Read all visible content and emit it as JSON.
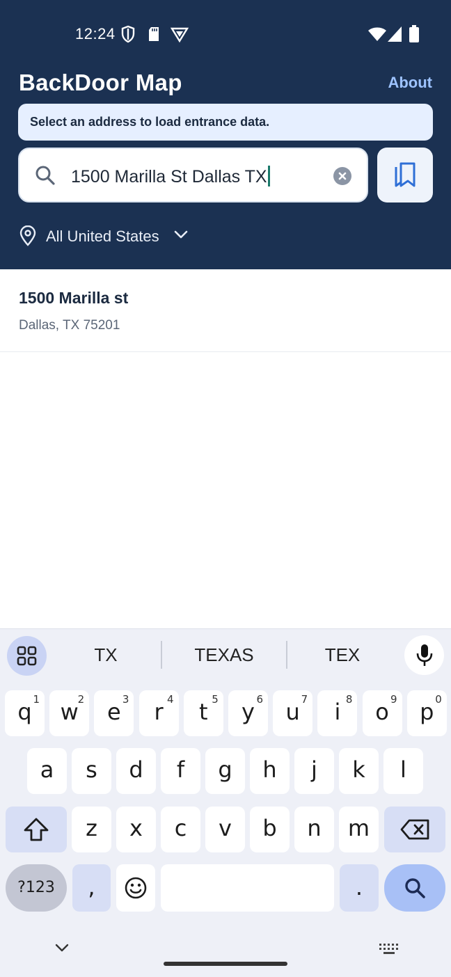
{
  "status_bar": {
    "time": "12:24"
  },
  "app": {
    "title": "BackDoor Map",
    "about_label": "About"
  },
  "banner": {
    "text": "Select an address to load entrance data."
  },
  "search": {
    "value": "1500 Marilla St Dallas TX"
  },
  "region": {
    "label": "All United States"
  },
  "results": [
    {
      "title": "1500 Marilla st",
      "subtitle": "Dallas, TX 75201"
    }
  ],
  "keyboard": {
    "suggestions": [
      "TX",
      "TEXAS",
      "TEX"
    ],
    "row1": [
      {
        "k": "q",
        "h": "1"
      },
      {
        "k": "w",
        "h": "2"
      },
      {
        "k": "e",
        "h": "3"
      },
      {
        "k": "r",
        "h": "4"
      },
      {
        "k": "t",
        "h": "5"
      },
      {
        "k": "y",
        "h": "6"
      },
      {
        "k": "u",
        "h": "7"
      },
      {
        "k": "i",
        "h": "8"
      },
      {
        "k": "o",
        "h": "9"
      },
      {
        "k": "p",
        "h": "0"
      }
    ],
    "row2": [
      "a",
      "s",
      "d",
      "f",
      "g",
      "h",
      "j",
      "k",
      "l"
    ],
    "row3": [
      "z",
      "x",
      "c",
      "v",
      "b",
      "n",
      "m"
    ],
    "symbols_label": "?123",
    "comma_label": ",",
    "period_label": "."
  },
  "colors": {
    "header_bg": "#1b3152",
    "accent": "#9ec3ff",
    "banner_bg": "#e6efff"
  }
}
